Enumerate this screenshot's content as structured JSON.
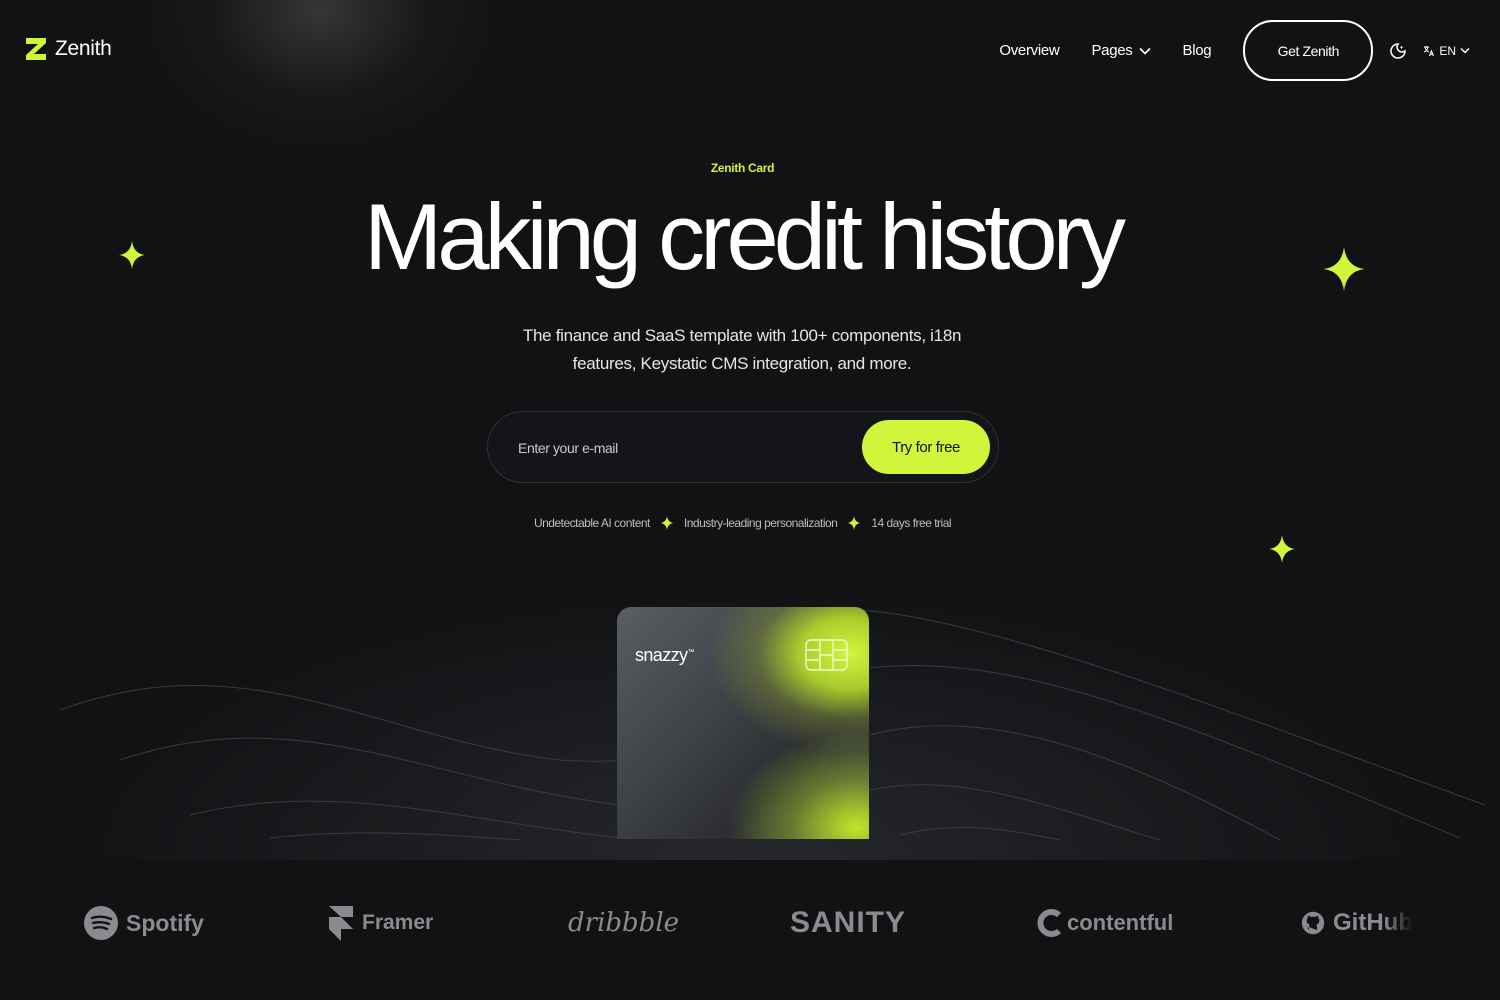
{
  "header": {
    "logo_text": "Zenith",
    "nav": [
      {
        "label": "Overview"
      },
      {
        "label": "Pages",
        "has_dropdown": true
      },
      {
        "label": "Blog"
      }
    ],
    "cta_label": "Get Zenith",
    "language": "EN"
  },
  "hero": {
    "eyebrow": "Zenith Card",
    "title": "Making credit history",
    "subtitle": "The finance and SaaS template with 100+ components, i18n features, Keystatic CMS integration, and more.",
    "email_placeholder": "Enter your e-mail",
    "email_value": "",
    "submit_label": "Try for free",
    "features": [
      "Undetectable AI content",
      "Industry-leading personalization",
      "14 days free trial"
    ]
  },
  "card": {
    "brand": "snazzy",
    "trademark": "™"
  },
  "logos": [
    "Spotify",
    "Framer",
    "dribbble",
    "SANITY",
    "contentful",
    "GitHub"
  ],
  "colors": {
    "accent": "#d2f53c",
    "background": "#111214",
    "text": "#ffffff",
    "muted": "#8a8b8e"
  }
}
